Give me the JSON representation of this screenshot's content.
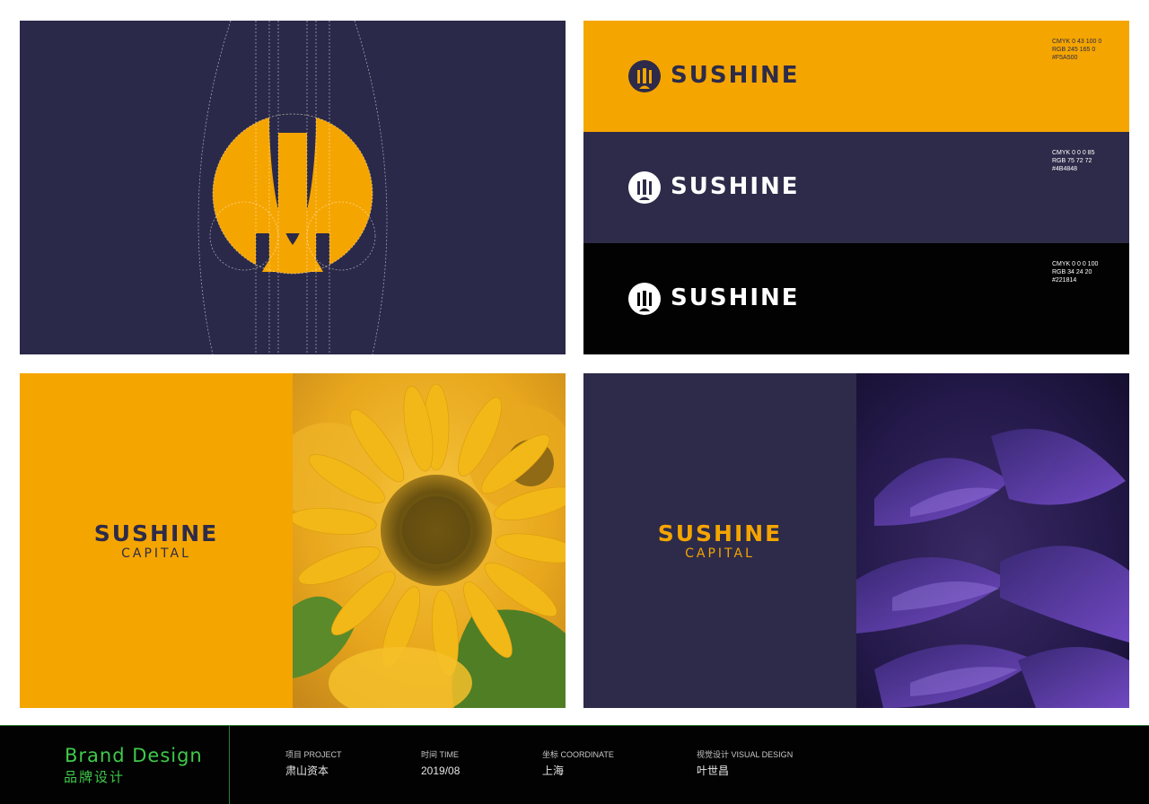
{
  "colors": {
    "orange": "#F5A500",
    "navy": "#2D2B49",
    "black": "#020202",
    "footer_green": "#3FC94A"
  },
  "logo_grid": {
    "icon": "sushine-mark-icon"
  },
  "color_bars": [
    {
      "wordmark": "SUSHINE",
      "spec_cmyk": "CMYK 0 43 100 0",
      "spec_rgb": "RGB 245 165 0",
      "spec_hex": "#F5A500",
      "bg": "#F5A500",
      "text_color": "#2D2B49"
    },
    {
      "wordmark": "SUSHINE",
      "spec_cmyk": "CMYK 0 0 0 85",
      "spec_rgb": "RGB 75 72 72",
      "spec_hex": "#4B4848",
      "bg": "#2D2B49",
      "text_color": "#FFFFFF"
    },
    {
      "wordmark": "SUSHINE",
      "spec_cmyk": "CMYK 0 0 0 100",
      "spec_rgb": "RGB 34 24 20",
      "spec_hex": "#221814",
      "bg": "#020202",
      "text_color": "#FFFFFF"
    }
  ],
  "sun_panel": {
    "brand": "SUSHINE",
    "sub": "CAPITAL",
    "image": "sunflower-photo"
  },
  "purple_panel": {
    "brand": "SUSHINE",
    "sub": "CAPITAL",
    "image": "purple-flower-photo"
  },
  "footer": {
    "title": "Brand Design",
    "subtitle": "品牌设计",
    "items": [
      {
        "label": "项目 PROJECT",
        "value": "肃山资本"
      },
      {
        "label": "时间 TIME",
        "value": "2019/08"
      },
      {
        "label": "坐标 COORDINATE",
        "value": "上海"
      },
      {
        "label": "视觉设计 VISUAL DESIGN",
        "value": "叶世昌"
      }
    ]
  }
}
